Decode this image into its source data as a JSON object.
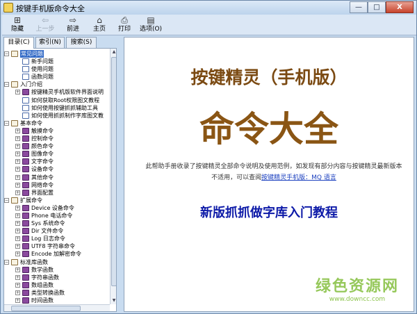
{
  "window": {
    "title": "按键手机版命令大全"
  },
  "title_buttons": {
    "minimize": "—",
    "maximize": "□",
    "close": "X"
  },
  "toolbar": [
    {
      "label": "隐藏",
      "icon": "hide-icon",
      "glyph": "⊞"
    },
    {
      "label": "上一步",
      "icon": "back-icon",
      "glyph": "⇦"
    },
    {
      "label": "前进",
      "icon": "forward-icon",
      "glyph": "⇨"
    },
    {
      "label": "主页",
      "icon": "home-icon",
      "glyph": "⌂"
    },
    {
      "label": "打印",
      "icon": "print-icon",
      "glyph": "⎙"
    },
    {
      "label": "选项(O)",
      "icon": "options-icon",
      "glyph": "▤"
    }
  ],
  "tabs": [
    "目录(C)",
    "索引(N)",
    "搜索(S)"
  ],
  "tree": [
    {
      "label": "常见问题",
      "level": 0,
      "icon": "open",
      "expander": "−",
      "selected": true
    },
    {
      "label": "新手问题",
      "level": 1,
      "icon": "page"
    },
    {
      "label": "使用问题",
      "level": 1,
      "icon": "page"
    },
    {
      "label": "函数问题",
      "level": 1,
      "icon": "page"
    },
    {
      "label": "入门介绍",
      "level": 0,
      "icon": "open",
      "expander": "−"
    },
    {
      "label": "按键精灵手机版软件界面说明",
      "level": 1,
      "icon": "book",
      "expander": "+"
    },
    {
      "label": "如何获取Root权限图文教程",
      "level": 1,
      "icon": "page"
    },
    {
      "label": "如何使用按键抓抓辅助工具",
      "level": 1,
      "icon": "page"
    },
    {
      "label": "如何使用抓抓制作字库图文教",
      "level": 1,
      "icon": "page"
    },
    {
      "label": "基本命令",
      "level": 0,
      "icon": "open",
      "expander": "−"
    },
    {
      "label": "触摸命令",
      "level": 1,
      "icon": "book",
      "expander": "+"
    },
    {
      "label": "控制命令",
      "level": 1,
      "icon": "book",
      "expander": "+"
    },
    {
      "label": "颜色命令",
      "level": 1,
      "icon": "book",
      "expander": "+"
    },
    {
      "label": "图像命令",
      "level": 1,
      "icon": "book",
      "expander": "+"
    },
    {
      "label": "文字命令",
      "level": 1,
      "icon": "book",
      "expander": "+"
    },
    {
      "label": "设备命令",
      "level": 1,
      "icon": "book",
      "expander": "+"
    },
    {
      "label": "其他命令",
      "level": 1,
      "icon": "book",
      "expander": "+"
    },
    {
      "label": "网络命令",
      "level": 1,
      "icon": "book",
      "expander": "+"
    },
    {
      "label": "界面配置",
      "level": 1,
      "icon": "book",
      "expander": "+"
    },
    {
      "label": "扩展命令",
      "level": 0,
      "icon": "open",
      "expander": "−"
    },
    {
      "label": "Device 设备命令",
      "level": 1,
      "icon": "book",
      "expander": "+"
    },
    {
      "label": "Phone 电话命令",
      "level": 1,
      "icon": "book",
      "expander": "+"
    },
    {
      "label": "Sys 系统命令",
      "level": 1,
      "icon": "book",
      "expander": "+"
    },
    {
      "label": "Dir 文件命令",
      "level": 1,
      "icon": "book",
      "expander": "+"
    },
    {
      "label": "Log 日志命令",
      "level": 1,
      "icon": "book",
      "expander": "+"
    },
    {
      "label": "UTF8 字符串命令",
      "level": 1,
      "icon": "book",
      "expander": "+"
    },
    {
      "label": "Encode 加解密命令",
      "level": 1,
      "icon": "book",
      "expander": "+"
    },
    {
      "label": "标准库函数",
      "level": 0,
      "icon": "open",
      "expander": "−"
    },
    {
      "label": "数学函数",
      "level": 1,
      "icon": "book",
      "expander": "+"
    },
    {
      "label": "字符串函数",
      "level": 1,
      "icon": "book",
      "expander": "+"
    },
    {
      "label": "数组函数",
      "level": 1,
      "icon": "book",
      "expander": "+"
    },
    {
      "label": "类型转换函数",
      "level": 1,
      "icon": "book",
      "expander": "+"
    },
    {
      "label": "时间函数",
      "level": 1,
      "icon": "book",
      "expander": "+"
    }
  ],
  "content": {
    "headline": "按键精灵（手机版）",
    "big_title": "命令大全",
    "desc_text": "此帮助手册收录了按键精灵全部命令说明及使用范例，如发现有部分内容与按键精灵最新版本不适用，可以查阅",
    "desc_link": "按键精灵手机版：MQ 语言",
    "tutorial_link": "新版抓抓做字库入门教程"
  },
  "watermark": {
    "cn": "绿色资源网",
    "url": "www.downcc.com"
  },
  "colors": {
    "headline": "#7b4a12",
    "tutorial": "#0d1aa8",
    "selection": "#3169c6",
    "watermark": "#8bc34a"
  }
}
